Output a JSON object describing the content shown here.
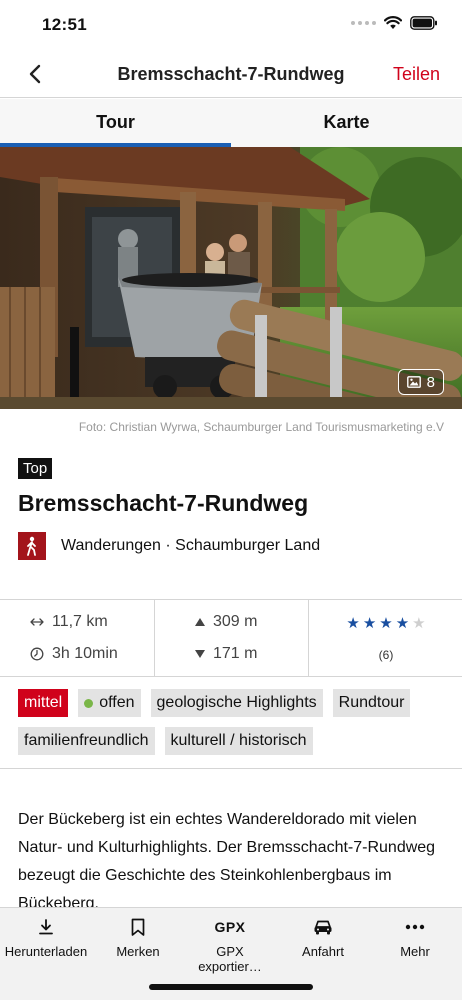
{
  "status_bar": {
    "time": "12:51"
  },
  "nav": {
    "title": "Bremsschacht-7-Rundweg",
    "share_label": "Teilen",
    "back_icon": "chevron-left-icon"
  },
  "tabs": [
    {
      "label": "Tour",
      "active": true
    },
    {
      "label": "Karte",
      "active": false
    }
  ],
  "hero": {
    "photo_count": "8",
    "credit": "Foto: Christian Wyrwa, Schaumburger Land Tourismusmarketing e.V"
  },
  "tour": {
    "badge": "Top",
    "title": "Bremsschacht-7-Rundweg",
    "category": "Wanderungen · Schaumburger Land"
  },
  "stats": {
    "distance": "11,7 km",
    "duration": "3h 10min",
    "ascent": "309 m",
    "descent": "171 m",
    "rating_stars": 4,
    "rating_max": 5,
    "rating_count": "(6)"
  },
  "tags": {
    "difficulty": "mittel",
    "status": "offen",
    "items": [
      "geologische Highlights",
      "Rundtour",
      "familienfreundlich",
      "kulturell / historisch"
    ]
  },
  "description": "Der Bückeberg ist ein echtes Wandereldorado mit vielen Natur- und Kulturhighlights. Der Bremsschacht-7-Rundweg bezeugt die Geschichte des Steinkohlenbergbaus im Bückeberg.",
  "toolbar": {
    "download": "Herunterladen",
    "bookmark": "Merken",
    "gpx_glyph": "GPX",
    "gpx": "GPX exportier…",
    "directions": "Anfahrt",
    "more": "Mehr"
  },
  "colors": {
    "accent_red": "#d0021b",
    "accent_blue": "#1a4fa0",
    "hike_icon_bg": "#a3141b",
    "status_green": "#7ab648"
  }
}
